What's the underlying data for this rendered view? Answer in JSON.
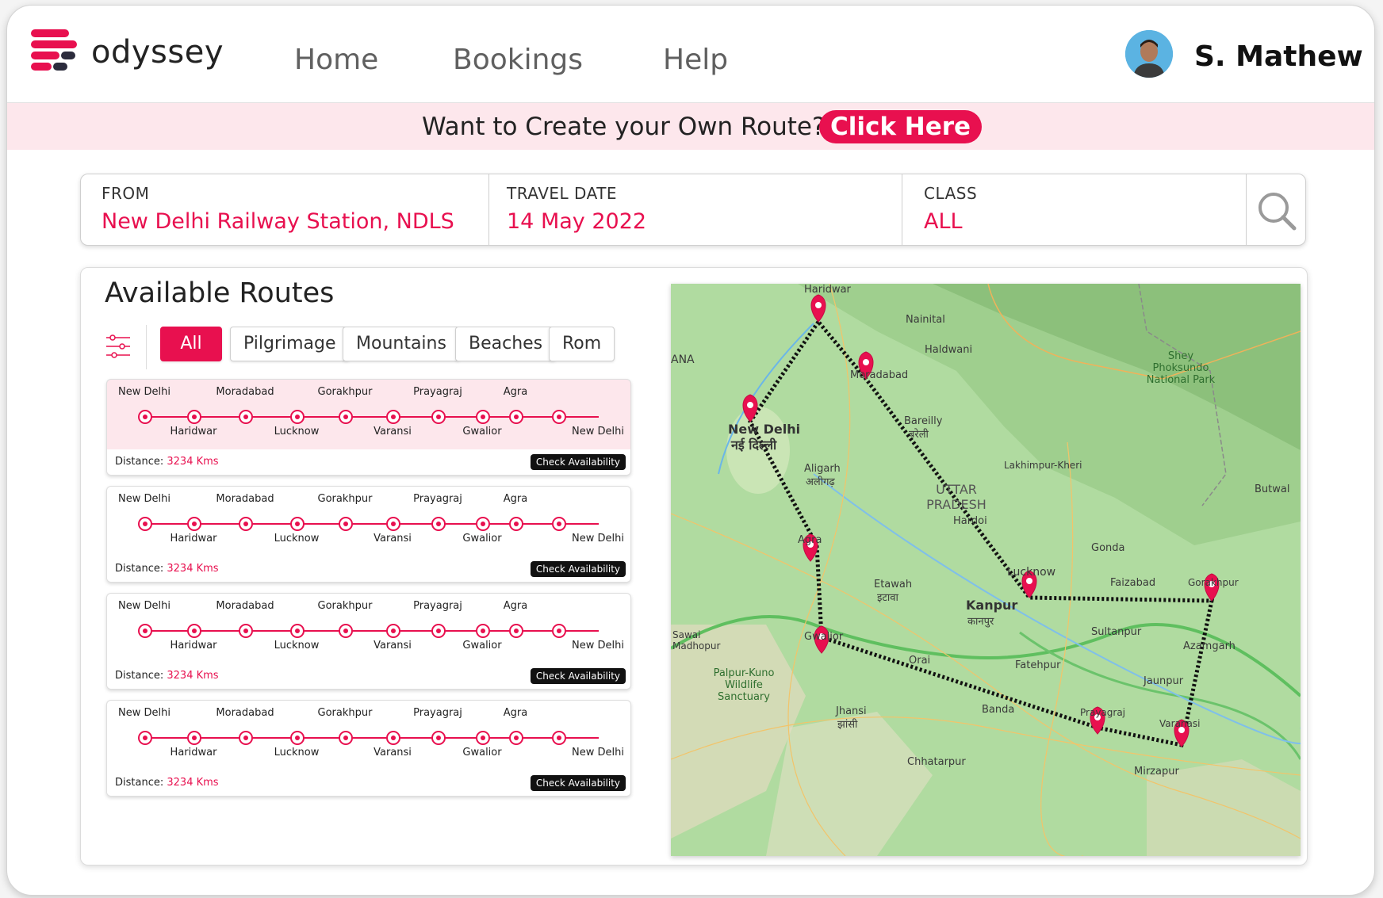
{
  "header": {
    "brand": "odyssey",
    "nav": [
      "Home",
      "Bookings",
      "Help"
    ],
    "user_name": "S. Mathew"
  },
  "banner": {
    "text": "Want to Create your Own Route?",
    "button": "Click Here"
  },
  "search": {
    "from_label": "FROM",
    "from_value": "New Delhi Railway Station, NDLS",
    "date_label": "TRAVEL DATE",
    "date_value": "14 May 2022",
    "class_label": "CLASS",
    "class_value": "ALL"
  },
  "routes": {
    "title": "Available Routes",
    "filters": [
      "All",
      "Pilgrimage",
      "Mountains",
      "Beaches",
      "Rom"
    ],
    "active_filter": "All",
    "top_stops": [
      "New Delhi",
      "Moradabad",
      "Gorakhpur",
      "Prayagraj",
      "Agra"
    ],
    "bottom_stops": [
      "Haridwar",
      "Lucknow",
      "Varansi",
      "Gwalior",
      "New Delhi"
    ],
    "distance_label": "Distance:",
    "distance_value": "3234 Kms",
    "button": "Check Availability"
  },
  "map": {
    "labels": [
      "Haridwar",
      "Nainital",
      "Haldwani",
      "Moradabad",
      "New Delhi",
      "नई दिल्ली",
      "Bareilly",
      "बरेली",
      "Aligarh",
      "अलीगढ़",
      "UTTAR PRADESH",
      "Shey Phoksundo National Park",
      "Lakhimpur-Kheri",
      "Hardoi",
      "Agra",
      "Gonda",
      "Lucknow",
      "Faizabad",
      "Gorakhpur",
      "Etawah",
      "इटावा",
      "Kanpur",
      "कानपुर",
      "Sultanpur",
      "Gwalior",
      "Azamgarh",
      "Sawai Madhopur",
      "Orai",
      "Palpur-Kuno Wildlife Sanctuary",
      "Fatehpur",
      "Jaunpur",
      "Jhansi",
      "झांसी",
      "Banda",
      "Prayagraj",
      "Varanasi",
      "Chhatarpur",
      "Mirzapur",
      "Butwal",
      "ANA"
    ]
  },
  "colors": {
    "accent": "#e8104f",
    "accent_light": "#fde7ec"
  }
}
